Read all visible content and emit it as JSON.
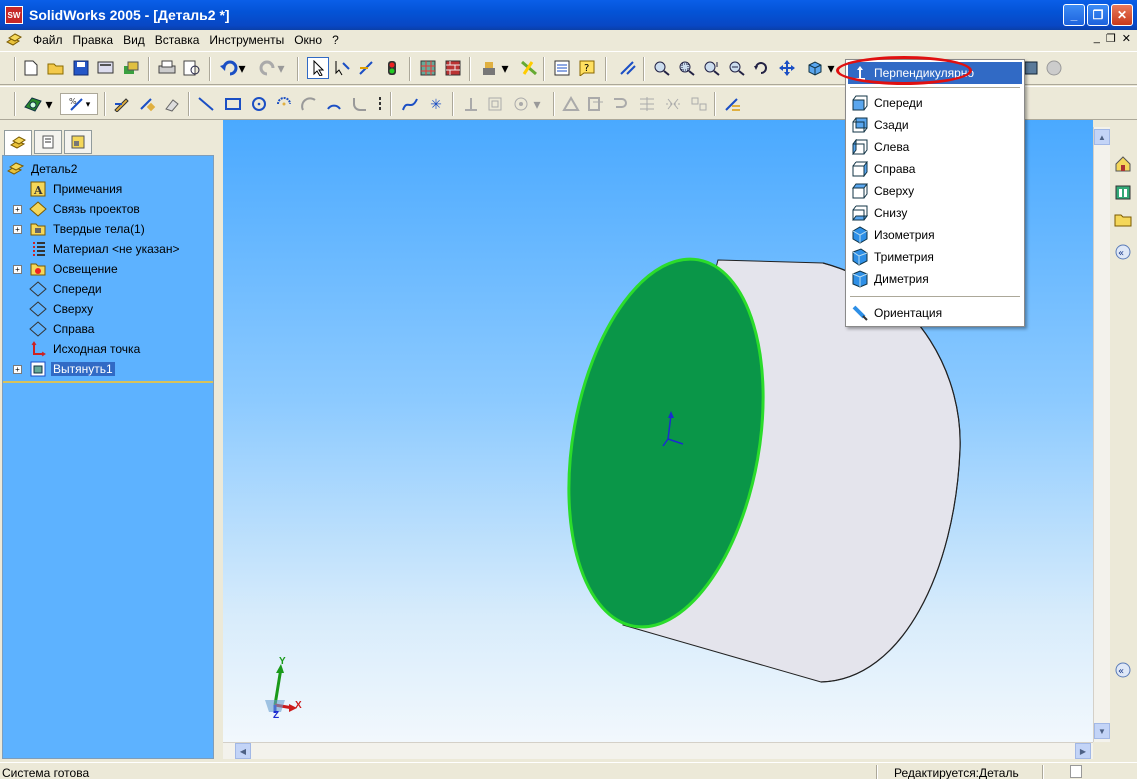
{
  "window": {
    "title": "SolidWorks 2005 - [Деталь2 *]",
    "app_icon_text": "SW"
  },
  "menubar": {
    "items": [
      "Файл",
      "Правка",
      "Вид",
      "Вставка",
      "Инструменты",
      "Окно",
      "?"
    ]
  },
  "toolbar1": {
    "icons": [
      "new-icon",
      "open-icon",
      "save-icon",
      "print-preview-icon",
      "options-icon",
      "print-icon",
      "preview-icon",
      "undo-icon",
      "redo-icon",
      "select-icon",
      "smart-dimension-icon",
      "sketch-icon",
      "rebuild-icon",
      "grid-icon",
      "texture-icon",
      "appearance-icon",
      "edit-color-icon",
      "properties-icon",
      "help-icon",
      "filter-icon",
      "zoom-fit-icon",
      "zoom-area-icon",
      "zoom-in-out-icon",
      "zoom-selection-icon",
      "rotate-view-icon",
      "pan-icon",
      "view-orientation-icon"
    ]
  },
  "toolbar2": {
    "icons": [
      "sketch-plane-icon",
      "dimension-icon",
      "sketch-pencil-icon",
      "smart-dimension-icon",
      "eraser-icon",
      "line-icon",
      "rectangle-icon",
      "circle-icon",
      "arc-center-icon",
      "arc-tangent-icon",
      "arc-3point-icon",
      "centerline-icon",
      "spline-icon",
      "point-icon",
      "relations-icon",
      "offset-icon",
      "mirror-icon",
      "trim-icon",
      "convert-icon",
      "extend-icon",
      "linear-pattern-icon",
      "fillet-sketch-icon"
    ]
  },
  "tree": {
    "tabs": [
      "feature-manager-tab",
      "property-manager-tab",
      "configuration-manager-tab"
    ],
    "root": "Деталь2",
    "items": [
      {
        "label": "Примечания",
        "icon": "annotations-icon",
        "expandable": false
      },
      {
        "label": "Связь проектов",
        "icon": "design-binder-icon",
        "expandable": true
      },
      {
        "label": "Твердые тела(1)",
        "icon": "solid-bodies-icon",
        "expandable": true
      },
      {
        "label": "Материал <не указан>",
        "icon": "material-icon",
        "expandable": false
      },
      {
        "label": "Освещение",
        "icon": "lighting-icon",
        "expandable": true
      },
      {
        "label": "Спереди",
        "icon": "plane-icon",
        "expandable": false
      },
      {
        "label": "Сверху",
        "icon": "plane-icon",
        "expandable": false
      },
      {
        "label": "Справа",
        "icon": "plane-icon",
        "expandable": false
      },
      {
        "label": "Исходная точка",
        "icon": "origin-icon",
        "expandable": false
      },
      {
        "label": "Вытянуть1",
        "icon": "extrude-icon",
        "expandable": true
      }
    ],
    "selected_index": 9
  },
  "view_menu": {
    "highlighted": "Перпендикулярно",
    "items": [
      "Спереди",
      "Сзади",
      "Слева",
      "Справа",
      "Сверху",
      "Снизу",
      "Изометрия",
      "Триметрия",
      "Диметрия"
    ],
    "footer": "Ориентация"
  },
  "triad": {
    "x": "X",
    "y": "Y",
    "z": "Z"
  },
  "status": {
    "left": "Система готова",
    "right": "Редактируется:Деталь"
  },
  "colors": {
    "face_green": "#0a9648",
    "edge_green": "#2bdc2b",
    "highlight_ellipse": "#e01010",
    "selection": "#316ac5"
  }
}
